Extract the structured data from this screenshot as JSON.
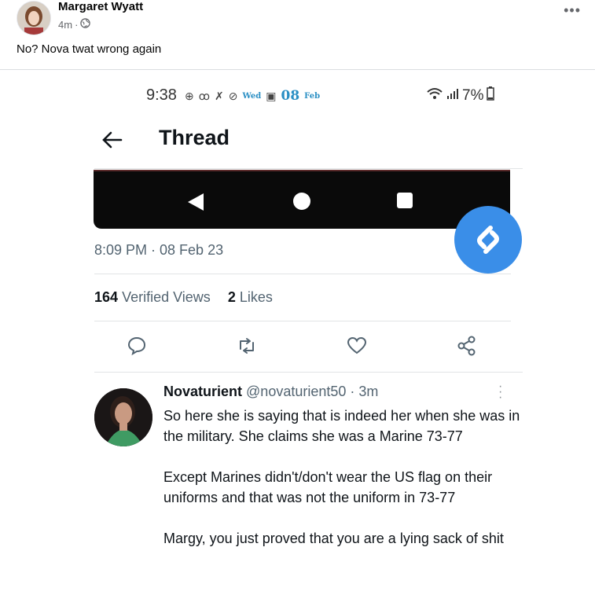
{
  "post": {
    "author": "Margaret Wyatt",
    "time": "4m",
    "separator": "·",
    "privacy_icon": "globe-icon",
    "more_icon": "more-dots-icon",
    "caption": "No? Nova twat wrong again"
  },
  "screenshot": {
    "status_bar": {
      "time": "9:38",
      "weekday": "Wed",
      "date": "08",
      "month": "Feb",
      "battery": "7%"
    },
    "header": {
      "title": "Thread"
    },
    "tweet": {
      "timestamp": "8:09 PM · 08 Feb 23",
      "views_count": "164",
      "views_label": "Verified Views",
      "likes_count": "2",
      "likes_label": "Likes"
    },
    "reply": {
      "name": "Novaturient",
      "handle": "@novaturient50",
      "time": "· 3m",
      "paragraphs": [
        "So here she is saying that is indeed her when she was in the military. She claims she was a Marine 73-77",
        "Except Marines didn't/don't wear the US flag on their uniforms and that was not the uniform in 73-77",
        "Margy, you just proved that you are a lying sack of shit"
      ]
    },
    "colors": {
      "shazam_blue": "#3a8ee8",
      "muted_text": "#536471"
    }
  }
}
